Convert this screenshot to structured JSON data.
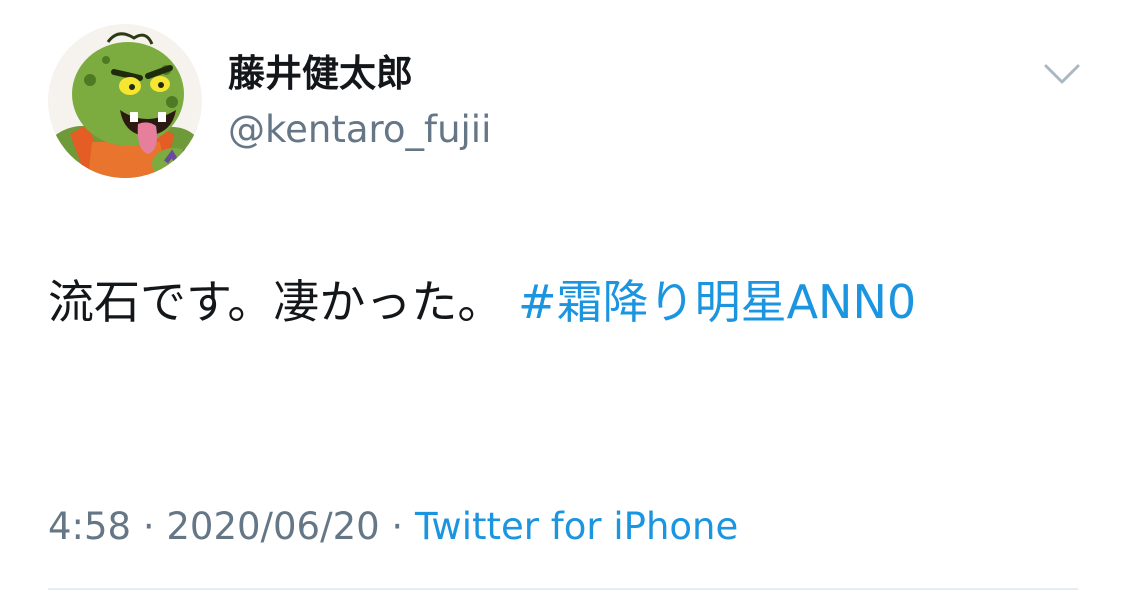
{
  "tweet": {
    "author": {
      "display_name": "藤井健太郎",
      "handle": "@kentaro_fujii",
      "avatar": "green-ogre-cartoon-avatar"
    },
    "menu_icon": "chevron-down-icon",
    "text": "流石です。凄かった。",
    "hashtag": "#霜降り明星ANN0",
    "time": "4:58",
    "separator": "·",
    "date": "2020/06/20",
    "source": "Twitter for iPhone"
  },
  "colors": {
    "text": "#14171a",
    "secondary": "#657786",
    "link": "#1b95e0",
    "divider": "#e6ecf0"
  }
}
